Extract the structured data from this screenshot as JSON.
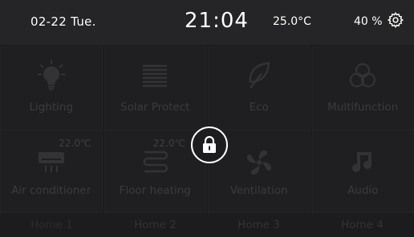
{
  "status": {
    "date": "02-22  Tue.",
    "time": "21:04",
    "temperature": "25.0°C",
    "humidity": "40 %",
    "settings_icon": "gear-icon"
  },
  "tiles": [
    {
      "label": "Lighting",
      "icon": "bulb-icon"
    },
    {
      "label": "Solar Protect",
      "icon": "blinds-icon"
    },
    {
      "label": "Eco",
      "icon": "leaf-icon"
    },
    {
      "label": "Multifunction",
      "icon": "multifunction-icon"
    },
    {
      "label": "Air conditioner",
      "icon": "air-conditioner-icon",
      "setpoint": "22.0℃"
    },
    {
      "label": "Floor heating",
      "icon": "floor-heating-icon",
      "setpoint": "22.0℃"
    },
    {
      "label": "Ventilation",
      "icon": "fan-icon"
    },
    {
      "label": "Audio",
      "icon": "music-note-icon"
    }
  ],
  "tabs": [
    {
      "label": "Home 1"
    },
    {
      "label": "Home 2"
    },
    {
      "label": "Home 3"
    },
    {
      "label": "Home 4"
    }
  ],
  "overlay": {
    "icon": "lock-icon"
  },
  "colors": {
    "background": "#1d1d1f",
    "statusbar": "#252527",
    "dimmed_icon": "#333336",
    "dimmed_text": "#3b3b3e",
    "text": "#ffffff"
  }
}
